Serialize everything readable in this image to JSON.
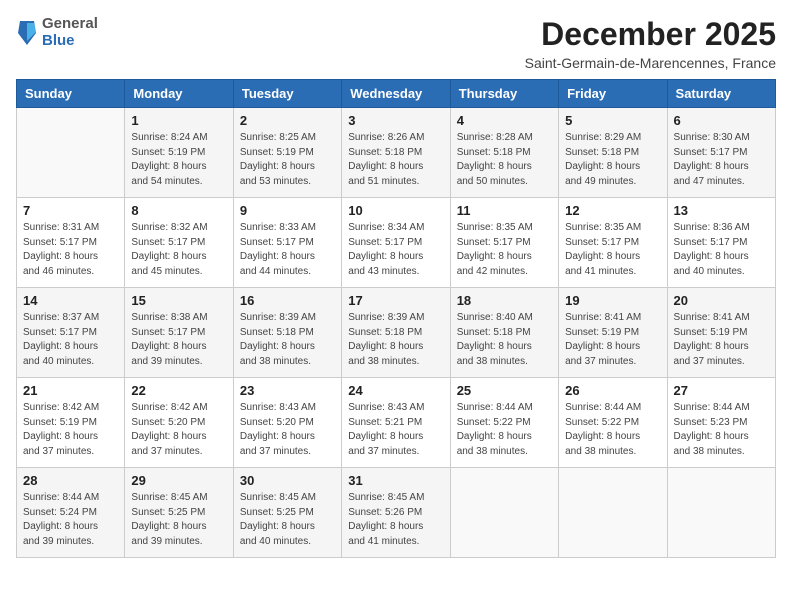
{
  "logo": {
    "general": "General",
    "blue": "Blue"
  },
  "title": "December 2025",
  "location": "Saint-Germain-de-Marencennes, France",
  "days_of_week": [
    "Sunday",
    "Monday",
    "Tuesday",
    "Wednesday",
    "Thursday",
    "Friday",
    "Saturday"
  ],
  "weeks": [
    [
      {
        "day": "",
        "info": ""
      },
      {
        "day": "1",
        "info": "Sunrise: 8:24 AM\nSunset: 5:19 PM\nDaylight: 8 hours\nand 54 minutes."
      },
      {
        "day": "2",
        "info": "Sunrise: 8:25 AM\nSunset: 5:19 PM\nDaylight: 8 hours\nand 53 minutes."
      },
      {
        "day": "3",
        "info": "Sunrise: 8:26 AM\nSunset: 5:18 PM\nDaylight: 8 hours\nand 51 minutes."
      },
      {
        "day": "4",
        "info": "Sunrise: 8:28 AM\nSunset: 5:18 PM\nDaylight: 8 hours\nand 50 minutes."
      },
      {
        "day": "5",
        "info": "Sunrise: 8:29 AM\nSunset: 5:18 PM\nDaylight: 8 hours\nand 49 minutes."
      },
      {
        "day": "6",
        "info": "Sunrise: 8:30 AM\nSunset: 5:17 PM\nDaylight: 8 hours\nand 47 minutes."
      }
    ],
    [
      {
        "day": "7",
        "info": "Sunrise: 8:31 AM\nSunset: 5:17 PM\nDaylight: 8 hours\nand 46 minutes."
      },
      {
        "day": "8",
        "info": "Sunrise: 8:32 AM\nSunset: 5:17 PM\nDaylight: 8 hours\nand 45 minutes."
      },
      {
        "day": "9",
        "info": "Sunrise: 8:33 AM\nSunset: 5:17 PM\nDaylight: 8 hours\nand 44 minutes."
      },
      {
        "day": "10",
        "info": "Sunrise: 8:34 AM\nSunset: 5:17 PM\nDaylight: 8 hours\nand 43 minutes."
      },
      {
        "day": "11",
        "info": "Sunrise: 8:35 AM\nSunset: 5:17 PM\nDaylight: 8 hours\nand 42 minutes."
      },
      {
        "day": "12",
        "info": "Sunrise: 8:35 AM\nSunset: 5:17 PM\nDaylight: 8 hours\nand 41 minutes."
      },
      {
        "day": "13",
        "info": "Sunrise: 8:36 AM\nSunset: 5:17 PM\nDaylight: 8 hours\nand 40 minutes."
      }
    ],
    [
      {
        "day": "14",
        "info": "Sunrise: 8:37 AM\nSunset: 5:17 PM\nDaylight: 8 hours\nand 40 minutes."
      },
      {
        "day": "15",
        "info": "Sunrise: 8:38 AM\nSunset: 5:17 PM\nDaylight: 8 hours\nand 39 minutes."
      },
      {
        "day": "16",
        "info": "Sunrise: 8:39 AM\nSunset: 5:18 PM\nDaylight: 8 hours\nand 38 minutes."
      },
      {
        "day": "17",
        "info": "Sunrise: 8:39 AM\nSunset: 5:18 PM\nDaylight: 8 hours\nand 38 minutes."
      },
      {
        "day": "18",
        "info": "Sunrise: 8:40 AM\nSunset: 5:18 PM\nDaylight: 8 hours\nand 38 minutes."
      },
      {
        "day": "19",
        "info": "Sunrise: 8:41 AM\nSunset: 5:19 PM\nDaylight: 8 hours\nand 37 minutes."
      },
      {
        "day": "20",
        "info": "Sunrise: 8:41 AM\nSunset: 5:19 PM\nDaylight: 8 hours\nand 37 minutes."
      }
    ],
    [
      {
        "day": "21",
        "info": "Sunrise: 8:42 AM\nSunset: 5:19 PM\nDaylight: 8 hours\nand 37 minutes."
      },
      {
        "day": "22",
        "info": "Sunrise: 8:42 AM\nSunset: 5:20 PM\nDaylight: 8 hours\nand 37 minutes."
      },
      {
        "day": "23",
        "info": "Sunrise: 8:43 AM\nSunset: 5:20 PM\nDaylight: 8 hours\nand 37 minutes."
      },
      {
        "day": "24",
        "info": "Sunrise: 8:43 AM\nSunset: 5:21 PM\nDaylight: 8 hours\nand 37 minutes."
      },
      {
        "day": "25",
        "info": "Sunrise: 8:44 AM\nSunset: 5:22 PM\nDaylight: 8 hours\nand 38 minutes."
      },
      {
        "day": "26",
        "info": "Sunrise: 8:44 AM\nSunset: 5:22 PM\nDaylight: 8 hours\nand 38 minutes."
      },
      {
        "day": "27",
        "info": "Sunrise: 8:44 AM\nSunset: 5:23 PM\nDaylight: 8 hours\nand 38 minutes."
      }
    ],
    [
      {
        "day": "28",
        "info": "Sunrise: 8:44 AM\nSunset: 5:24 PM\nDaylight: 8 hours\nand 39 minutes."
      },
      {
        "day": "29",
        "info": "Sunrise: 8:45 AM\nSunset: 5:25 PM\nDaylight: 8 hours\nand 39 minutes."
      },
      {
        "day": "30",
        "info": "Sunrise: 8:45 AM\nSunset: 5:25 PM\nDaylight: 8 hours\nand 40 minutes."
      },
      {
        "day": "31",
        "info": "Sunrise: 8:45 AM\nSunset: 5:26 PM\nDaylight: 8 hours\nand 41 minutes."
      },
      {
        "day": "",
        "info": ""
      },
      {
        "day": "",
        "info": ""
      },
      {
        "day": "",
        "info": ""
      }
    ]
  ]
}
